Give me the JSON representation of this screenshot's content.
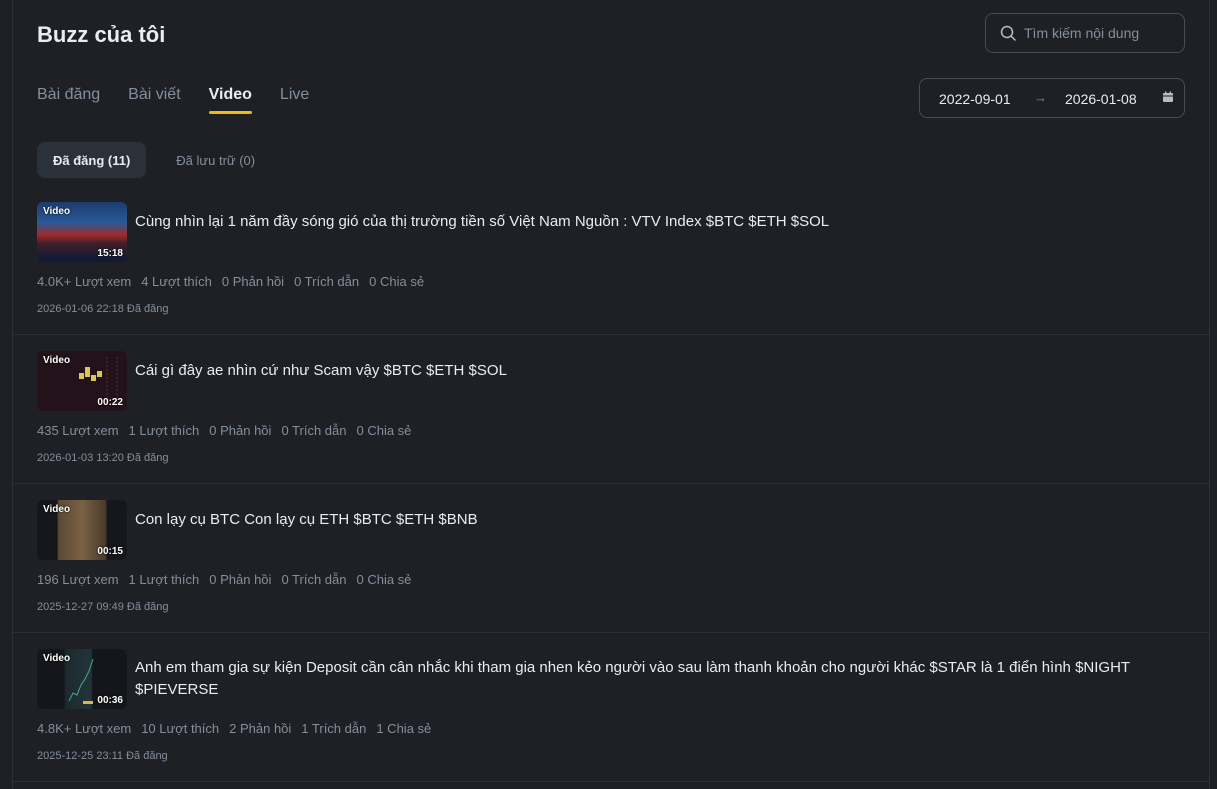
{
  "header": {
    "title": "Buzz của tôi",
    "search_placeholder": "Tìm kiếm nội dung"
  },
  "tabs": [
    {
      "label": "Bài đăng"
    },
    {
      "label": "Bài viết"
    },
    {
      "label": "Video"
    },
    {
      "label": "Live"
    }
  ],
  "active_tab": "Video",
  "date_range": {
    "start": "2022-09-01",
    "arrow": "→",
    "end": "2026-01-08"
  },
  "subtabs": [
    {
      "label": "Đã đăng (11)"
    },
    {
      "label": "Đã lưu trữ (0)"
    }
  ],
  "posts": [
    {
      "badge": "Video",
      "duration": "15:18",
      "title": "Cùng nhìn lại 1 năm đầy sóng gió của thị trường tiền số Việt Nam Nguồn : VTV Index $BTC $ETH $SOL",
      "views": "4.0K+ Lượt xem",
      "likes": "4 Lượt thích",
      "replies": "0 Phản hồi",
      "quotes": "0 Trích dẫn",
      "shares": "0 Chia sẻ",
      "date": "2026-01-06 22:18 Đã đăng"
    },
    {
      "badge": "Video",
      "duration": "00:22",
      "title": "Cái gì đây ae nhìn cứ như Scam vậy $BTC $ETH $SOL",
      "views": "435 Lượt xem",
      "likes": "1 Lượt thích",
      "replies": "0 Phản hồi",
      "quotes": "0 Trích dẫn",
      "shares": "0 Chia sẻ",
      "date": "2026-01-03 13:20 Đã đăng"
    },
    {
      "badge": "Video",
      "duration": "00:15",
      "title": "Con lạy cụ BTC Con lạy cụ ETH $BTC $ETH $BNB",
      "views": "196 Lượt xem",
      "likes": "1 Lượt thích",
      "replies": "0 Phản hồi",
      "quotes": "0 Trích dẫn",
      "shares": "0 Chia sẻ",
      "date": "2025-12-27 09:49 Đã đăng"
    },
    {
      "badge": "Video",
      "duration": "00:36",
      "title": "Anh em tham gia sự kiện Deposit cần cân nhắc khi tham gia nhen kẻo người vào sau làm thanh khoản cho người khác $STAR là 1 điển hình $NIGHT $PIEVERSE",
      "views": "4.8K+ Lượt xem",
      "likes": "10 Lượt thích",
      "replies": "2 Phản hồi",
      "quotes": "1 Trích dẫn",
      "shares": "1 Chia sẻ",
      "date": "2025-12-25 23:11 Đã đăng"
    }
  ],
  "colors": {
    "background": "#1e2026",
    "accent": "#f0b90b",
    "muted_text": "#848e9c",
    "border": "#2b3139"
  }
}
